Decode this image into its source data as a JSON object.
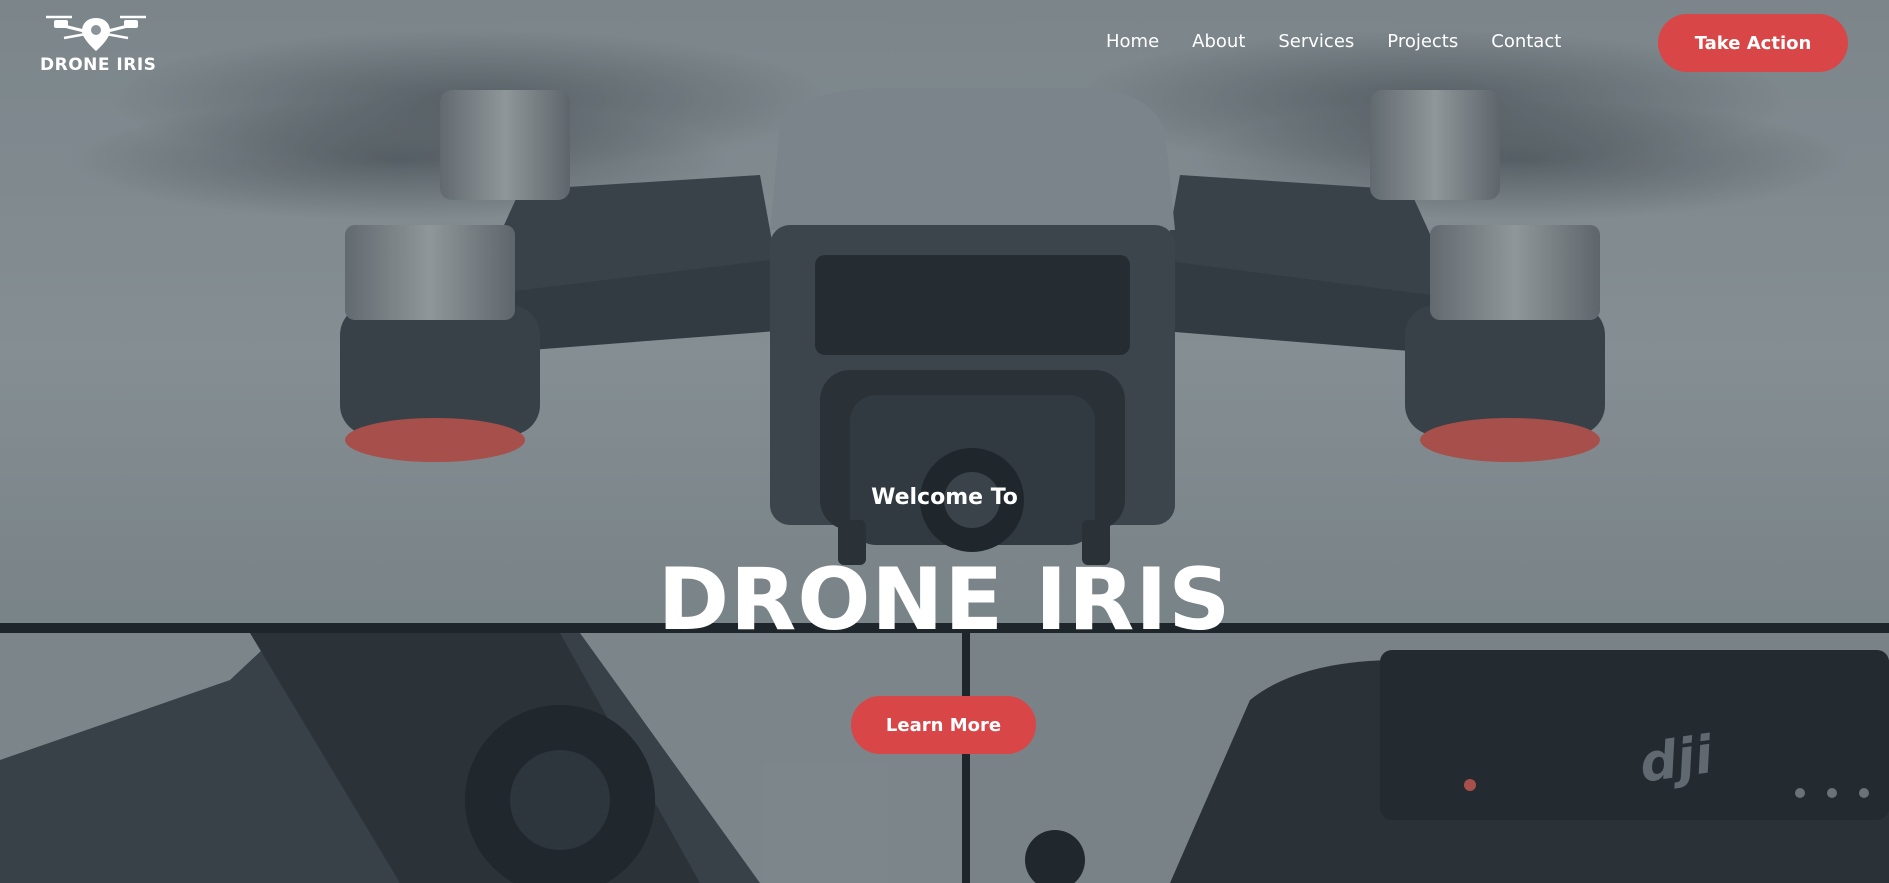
{
  "brand": {
    "name": "DRONE IRIS",
    "logo_icon": "drone-pin-icon"
  },
  "nav": {
    "items": [
      {
        "label": "Home"
      },
      {
        "label": "About"
      },
      {
        "label": "Services"
      },
      {
        "label": "Projects"
      },
      {
        "label": "Contact"
      }
    ],
    "cta_label": "Take Action"
  },
  "hero": {
    "welcome": "Welcome To",
    "title": "DRONE IRIS",
    "cta_label": "Learn More",
    "background": "drone-photo"
  },
  "colors": {
    "accent": "#d94648",
    "text": "#ffffff",
    "photo_tint": "#8e989d"
  }
}
